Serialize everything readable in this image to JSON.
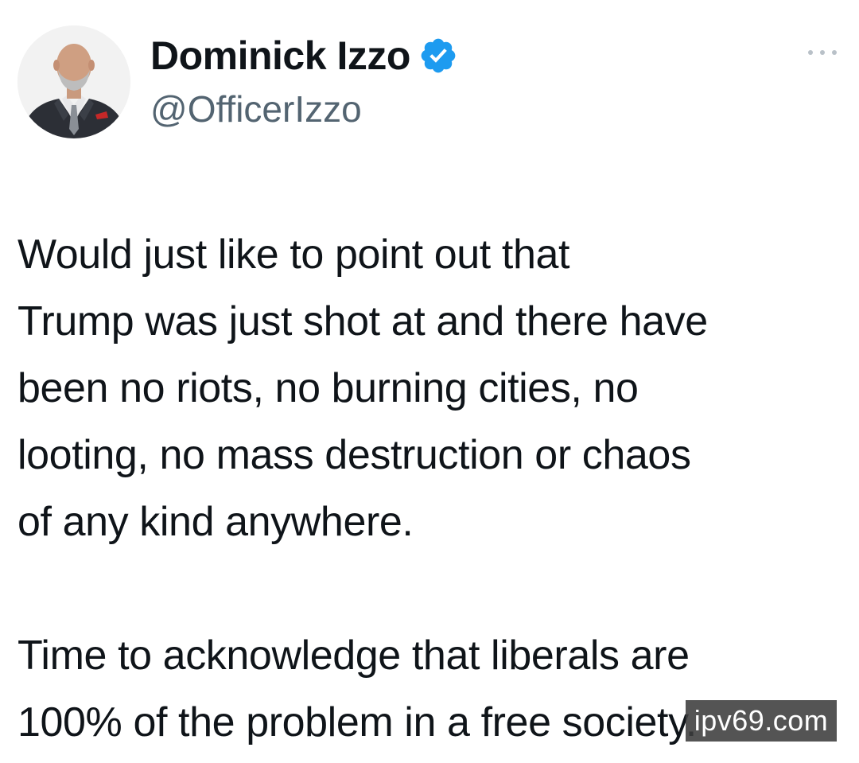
{
  "author": {
    "display_name": "Dominick Izzo",
    "handle": "@OfficerIzzo",
    "verified": true,
    "verified_color": "#1d9bf0",
    "avatar_icon": "profile-photo"
  },
  "menu": {
    "more_icon": "more-options-icon"
  },
  "tweet": {
    "paragraph_1": "Would just like to point out that\nTrump was just shot at and there have\nbeen no riots, no burning cities, no\nlooting, no mass destruction or chaos\nof any kind anywhere.",
    "paragraph_2": "Time to acknowledge that liberals are\n100% of the problem in a free society."
  },
  "watermark": {
    "text": "ipv69.com"
  },
  "colors": {
    "text": "#0f1419",
    "secondary_text": "#536471",
    "background": "#ffffff"
  }
}
